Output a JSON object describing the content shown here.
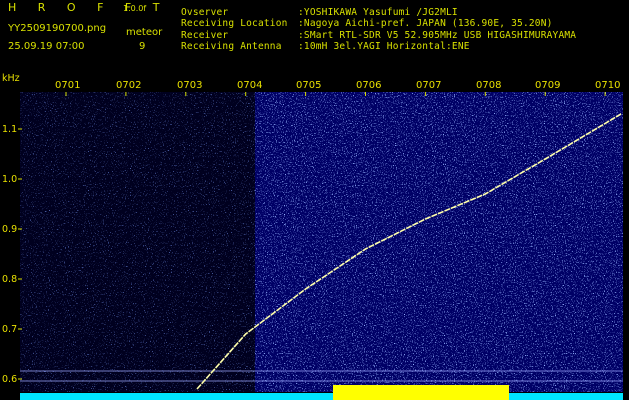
{
  "header": {
    "app_title": "H R O F F T",
    "version": "1.0.0f",
    "filename": "YY2509190700.png",
    "datetime": "25.09.19 07:00",
    "meteor_label": "meteor",
    "meteor_count": "9",
    "fields": [
      {
        "label": "Ovserver",
        "value": ":YOSHIKAWA Yasufumi /JG2MLI"
      },
      {
        "label": "Receiving Location",
        "value": ":Nagoya Aichi-pref. JAPAN (136.90E, 35.20N)"
      },
      {
        "label": "Receiver",
        "value": ":SMart RTL-SDR V5 52.905MHz USB HIGASHIMURAYAMA"
      },
      {
        "label": "Receiving Antenna",
        "value": ":10mH 3el.YAGI Horizontal:ENE"
      }
    ]
  },
  "chart_data": {
    "type": "spectrogram",
    "ylabel": "kHz",
    "x_ticks": [
      "0701",
      "0702",
      "0703",
      "0704",
      "0705",
      "0706",
      "0707",
      "0708",
      "0709",
      "0710"
    ],
    "y_ticks": [
      "1.1",
      "1.0",
      "0.9",
      "0.8",
      "0.7",
      "0.6"
    ],
    "ylim": [
      0.58,
      1.16
    ],
    "trace": [
      {
        "x": "0703",
        "y": 0.58
      },
      {
        "x": "0704",
        "y": 0.69
      },
      {
        "x": "0705",
        "y": 0.78
      },
      {
        "x": "0706",
        "y": 0.86
      },
      {
        "x": "0707",
        "y": 0.92
      },
      {
        "x": "0708",
        "y": 0.97
      },
      {
        "x": "0709",
        "y": 1.04
      },
      {
        "x": "0710",
        "y": 1.13
      }
    ],
    "colors": {
      "background": "#00007a",
      "noise": "#4a6cff",
      "trace": "#ffffaa",
      "power_bar": "#00e5ff",
      "power_burst": "#ffff00",
      "text": "#d8e000"
    }
  }
}
